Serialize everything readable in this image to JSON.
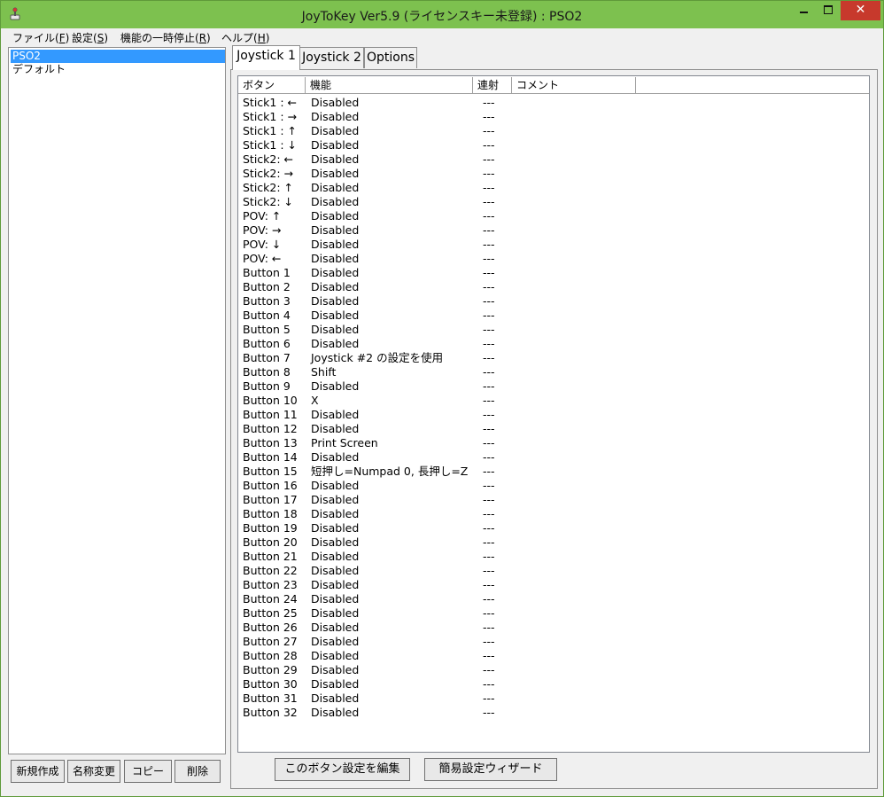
{
  "window": {
    "title": "JoyToKey Ver5.9 (ライセンスキー未登録) : PSO2",
    "icon": "joystick-app-icon",
    "close_label": "✕",
    "colors": {
      "titlebar": "#7dc14f",
      "close": "#c7392c",
      "selection": "#3399ff"
    }
  },
  "menu": [
    {
      "text": "ファイル(",
      "key": "F",
      "tail": ")"
    },
    {
      "text": "設定(",
      "key": "S",
      "tail": ")"
    },
    {
      "text": "機能の一時停止(",
      "key": "R",
      "tail": ")"
    },
    {
      "text": "ヘルプ(",
      "key": "H",
      "tail": ")"
    }
  ],
  "profiles": [
    {
      "label": "PSO2",
      "selected": true
    },
    {
      "label": "デフォルト",
      "selected": false
    }
  ],
  "left_buttons": {
    "new": "新規作成",
    "rename": "名称変更",
    "copy": "コピー",
    "delete": "削除"
  },
  "tabs": [
    {
      "label": "Joystick 1",
      "active": true
    },
    {
      "label": "Joystick 2",
      "active": false
    },
    {
      "label": "Options",
      "active": false
    }
  ],
  "columns": {
    "button": "ボタン",
    "function": "機能",
    "rapid": "連射",
    "comment": "コメント"
  },
  "rows": [
    {
      "button": "Stick1 : ←",
      "function": "Disabled",
      "rapid": "---"
    },
    {
      "button": "Stick1 : →",
      "function": "Disabled",
      "rapid": "---"
    },
    {
      "button": "Stick1 : ↑",
      "function": "Disabled",
      "rapid": "---"
    },
    {
      "button": "Stick1 : ↓",
      "function": "Disabled",
      "rapid": "---"
    },
    {
      "button": "Stick2: ←",
      "function": "Disabled",
      "rapid": "---"
    },
    {
      "button": "Stick2: →",
      "function": "Disabled",
      "rapid": "---"
    },
    {
      "button": "Stick2: ↑",
      "function": "Disabled",
      "rapid": "---"
    },
    {
      "button": "Stick2: ↓",
      "function": "Disabled",
      "rapid": "---"
    },
    {
      "button": "POV: ↑",
      "function": "Disabled",
      "rapid": "---"
    },
    {
      "button": "POV: →",
      "function": "Disabled",
      "rapid": "---"
    },
    {
      "button": "POV: ↓",
      "function": "Disabled",
      "rapid": "---"
    },
    {
      "button": "POV: ←",
      "function": "Disabled",
      "rapid": "---"
    },
    {
      "button": "Button 1",
      "function": "Disabled",
      "rapid": "---"
    },
    {
      "button": "Button 2",
      "function": "Disabled",
      "rapid": "---"
    },
    {
      "button": "Button 3",
      "function": "Disabled",
      "rapid": "---"
    },
    {
      "button": "Button 4",
      "function": "Disabled",
      "rapid": "---"
    },
    {
      "button": "Button 5",
      "function": "Disabled",
      "rapid": "---"
    },
    {
      "button": "Button 6",
      "function": "Disabled",
      "rapid": "---"
    },
    {
      "button": "Button 7",
      "function": "Joystick #2 の設定を使用",
      "rapid": "---"
    },
    {
      "button": "Button 8",
      "function": "Shift",
      "rapid": "---"
    },
    {
      "button": "Button 9",
      "function": "Disabled",
      "rapid": "---"
    },
    {
      "button": "Button 10",
      "function": "X",
      "rapid": "---"
    },
    {
      "button": "Button 11",
      "function": "Disabled",
      "rapid": "---"
    },
    {
      "button": "Button 12",
      "function": "Disabled",
      "rapid": "---"
    },
    {
      "button": "Button 13",
      "function": "Print Screen",
      "rapid": "---"
    },
    {
      "button": "Button 14",
      "function": "Disabled",
      "rapid": "---"
    },
    {
      "button": "Button 15",
      "function": "短押し=Numpad 0, 長押し=Z",
      "rapid": "---"
    },
    {
      "button": "Button 16",
      "function": "Disabled",
      "rapid": "---"
    },
    {
      "button": "Button 17",
      "function": "Disabled",
      "rapid": "---"
    },
    {
      "button": "Button 18",
      "function": "Disabled",
      "rapid": "---"
    },
    {
      "button": "Button 19",
      "function": "Disabled",
      "rapid": "---"
    },
    {
      "button": "Button 20",
      "function": "Disabled",
      "rapid": "---"
    },
    {
      "button": "Button 21",
      "function": "Disabled",
      "rapid": "---"
    },
    {
      "button": "Button 22",
      "function": "Disabled",
      "rapid": "---"
    },
    {
      "button": "Button 23",
      "function": "Disabled",
      "rapid": "---"
    },
    {
      "button": "Button 24",
      "function": "Disabled",
      "rapid": "---"
    },
    {
      "button": "Button 25",
      "function": "Disabled",
      "rapid": "---"
    },
    {
      "button": "Button 26",
      "function": "Disabled",
      "rapid": "---"
    },
    {
      "button": "Button 27",
      "function": "Disabled",
      "rapid": "---"
    },
    {
      "button": "Button 28",
      "function": "Disabled",
      "rapid": "---"
    },
    {
      "button": "Button 29",
      "function": "Disabled",
      "rapid": "---"
    },
    {
      "button": "Button 30",
      "function": "Disabled",
      "rapid": "---"
    },
    {
      "button": "Button 31",
      "function": "Disabled",
      "rapid": "---"
    },
    {
      "button": "Button 32",
      "function": "Disabled",
      "rapid": "---"
    }
  ],
  "bottom_buttons": {
    "edit": "このボタン設定を編集",
    "wizard": "簡易設定ウィザード"
  }
}
